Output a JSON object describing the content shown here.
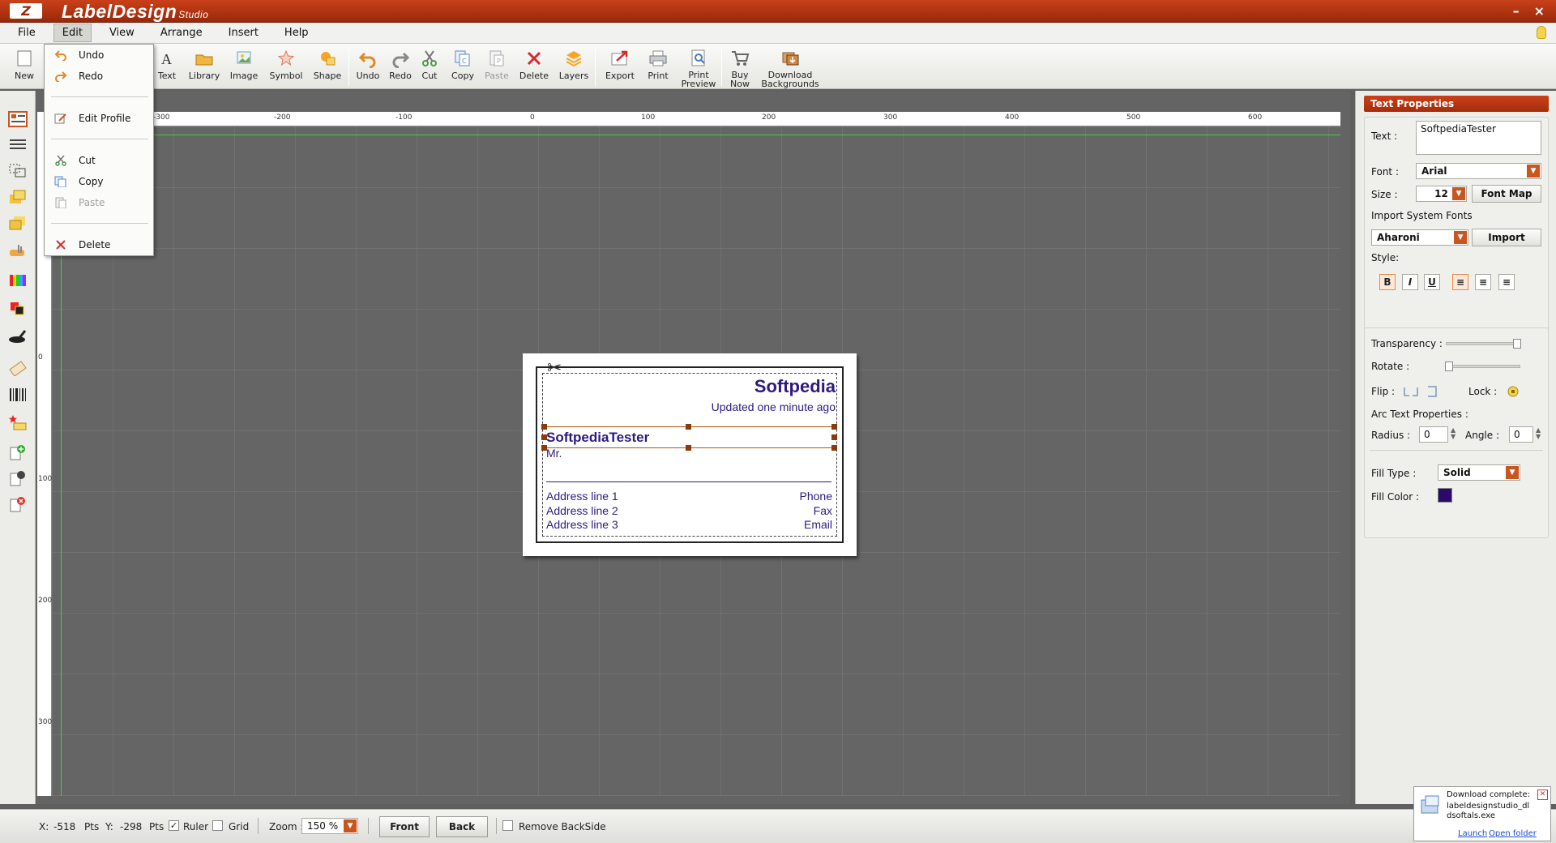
{
  "app": {
    "logo": "Z",
    "title": "LabelDesign",
    "subtitle": "Studio",
    "minimize": "–",
    "close": "×"
  },
  "menu": [
    "File",
    "Edit",
    "View",
    "Arrange",
    "Insert",
    "Help"
  ],
  "toolbar": {
    "new": "New",
    "text": "Text",
    "library": "Library",
    "image": "Image",
    "symbol": "Symbol",
    "shape": "Shape",
    "undo": "Undo",
    "redo": "Redo",
    "cut": "Cut",
    "copy": "Copy",
    "paste": "Paste",
    "delete": "Delete",
    "layers": "Layers",
    "export": "Export",
    "print": "Print",
    "print_preview": "Print Preview",
    "buy_now": "Buy Now",
    "download_backgrounds": "Download Backgrounds"
  },
  "edit_menu": {
    "undo": "Undo",
    "redo": "Redo",
    "edit_profile": "Edit Profile",
    "cut": "Cut",
    "copy": "Copy",
    "paste": "Paste",
    "delete": "Delete"
  },
  "ruler": {
    "top": [
      "-300",
      "-200",
      "-100",
      "0",
      "100",
      "200",
      "300",
      "400",
      "500",
      "600"
    ],
    "left": [
      "0",
      "100",
      "200",
      "300"
    ]
  },
  "label": {
    "company": "Softpedia",
    "updated": "Updated one minute ago",
    "name": "SoftpediaTester",
    "title": "Mr.",
    "address1": "Address line 1",
    "address2": "Address line 2",
    "address3": "Address line 3",
    "phone": "Phone",
    "fax": "Fax",
    "email": "Email"
  },
  "text_properties": {
    "header": "Text Properties",
    "text_label": "Text :",
    "text_value": "SoftpediaTester",
    "font_label": "Font :",
    "font_value": "Arial",
    "size_label": "Size :",
    "size_value": "12",
    "font_map": "Font Map",
    "import_system_fonts": "Import System Fonts",
    "system_font_value": "Aharoni",
    "import": "Import",
    "style_label": "Style:",
    "bold": "B",
    "italic": "I",
    "underline": "U",
    "transparency_label": "Transparency :",
    "rotate_label": "Rotate :",
    "flip_label": "Flip :",
    "lock_label": "Lock :",
    "arc_text": "Arc Text Properties :",
    "radius_label": "Radius :",
    "radius_value": "0",
    "angle_label": "Angle :",
    "angle_value": "0",
    "fill_type_label": "Fill Type :",
    "fill_type_value": "Solid",
    "fill_color_label": "Fill Color :",
    "fill_color": "#2b0a6b"
  },
  "status": {
    "x_label": "X:",
    "x_value": "-518",
    "x_unit": "Pts",
    "y_label": "Y:",
    "y_value": "-298",
    "y_unit": "Pts",
    "ruler": "Ruler",
    "grid": "Grid",
    "zoom_label": "Zoom :",
    "zoom_value": "150 %",
    "front": "Front",
    "back": "Back",
    "remove_backside": "Remove BackSide"
  },
  "download_notice": {
    "title": "Download complete:",
    "file": "labeldesignstudio_dldsoftals.exe",
    "launch": "Launch",
    "open_folder": "Open folder"
  },
  "colors": {
    "brand": "#b5330f",
    "label_text": "#2e1a80",
    "selection": "#b5560e"
  }
}
